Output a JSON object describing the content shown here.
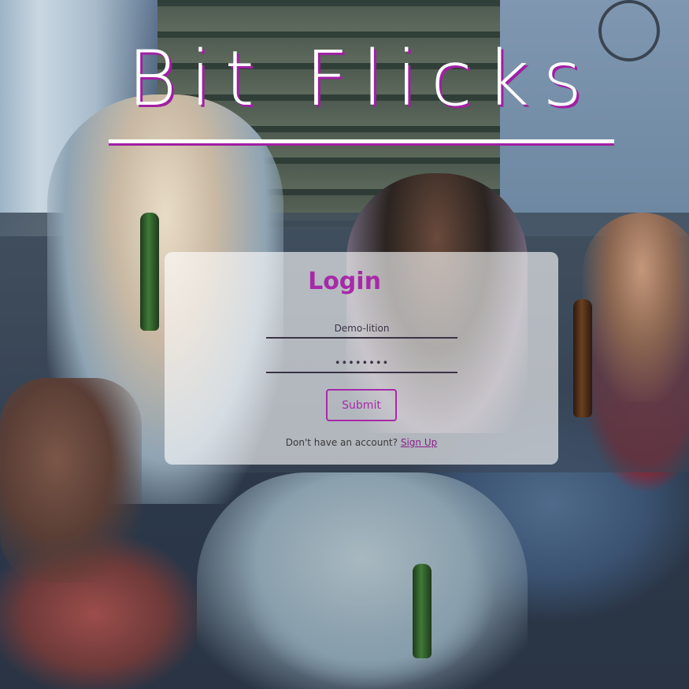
{
  "app": {
    "title": "Bit Flicks"
  },
  "login": {
    "heading": "Login",
    "username_value": "Demo-lition",
    "password_value": "••••••••",
    "submit_label": "Submit",
    "signup_prompt": "Don't have an account?",
    "signup_link": "Sign Up"
  },
  "colors": {
    "accent": "#a62aa8",
    "title_shadow": "#a11fa3",
    "card_background": "rgba(255,255,255,0.62)"
  }
}
